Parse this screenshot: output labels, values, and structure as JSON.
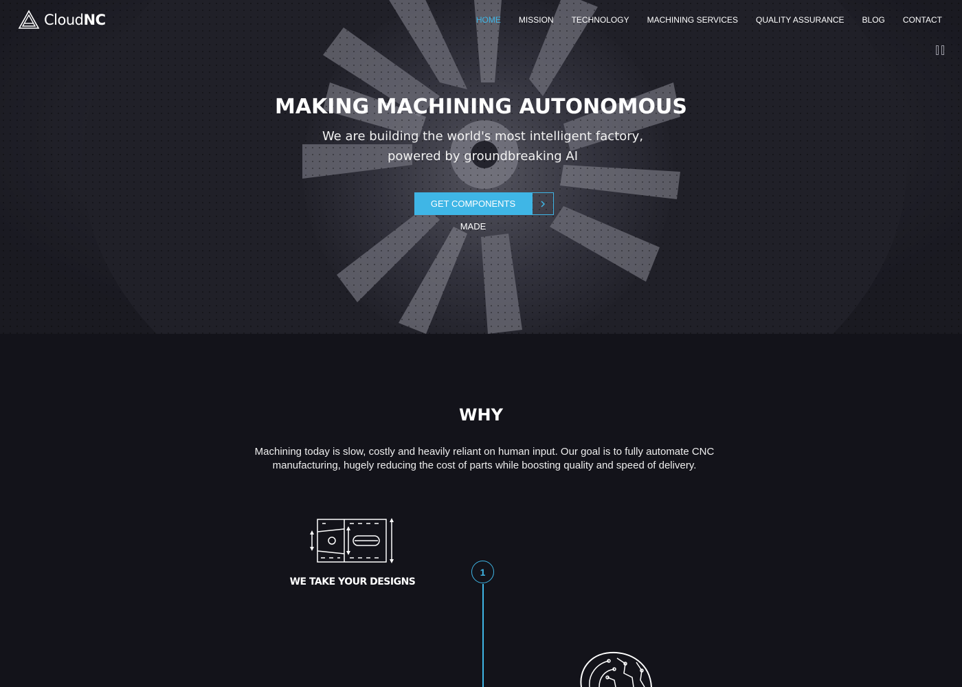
{
  "brand": {
    "name_light": "Cloud",
    "name_bold": "NC"
  },
  "nav": {
    "items": [
      {
        "label": "HOME",
        "active": true
      },
      {
        "label": "MISSION"
      },
      {
        "label": "TECHNOLOGY"
      },
      {
        "label": "MACHINING SERVICES"
      },
      {
        "label": "QUALITY ASSURANCE"
      },
      {
        "label": "BLOG"
      },
      {
        "label": "CONTACT"
      }
    ]
  },
  "hero": {
    "title": "MAKING MACHINING AUTONOMOUS",
    "subtitle": "We are building the world's most intelligent factory, powered by groundbreaking AI",
    "cta_label": "GET COMPONENTS MADE",
    "cta_icon": "chevron-right-icon",
    "pause_icon": "pause-icon"
  },
  "why": {
    "title": "WHY",
    "text": "Machining today is slow, costly and heavily reliant on human input. Our goal is to fully automate CNC manufacturing, hugely reducing the cost of parts while boosting quality and speed of delivery.",
    "steps": [
      {
        "number": "1",
        "title": "WE TAKE YOUR DESIGNS",
        "icon": "design-drawing-icon"
      }
    ]
  },
  "colors": {
    "accent": "#3fb6e6",
    "background": "#13131a"
  }
}
